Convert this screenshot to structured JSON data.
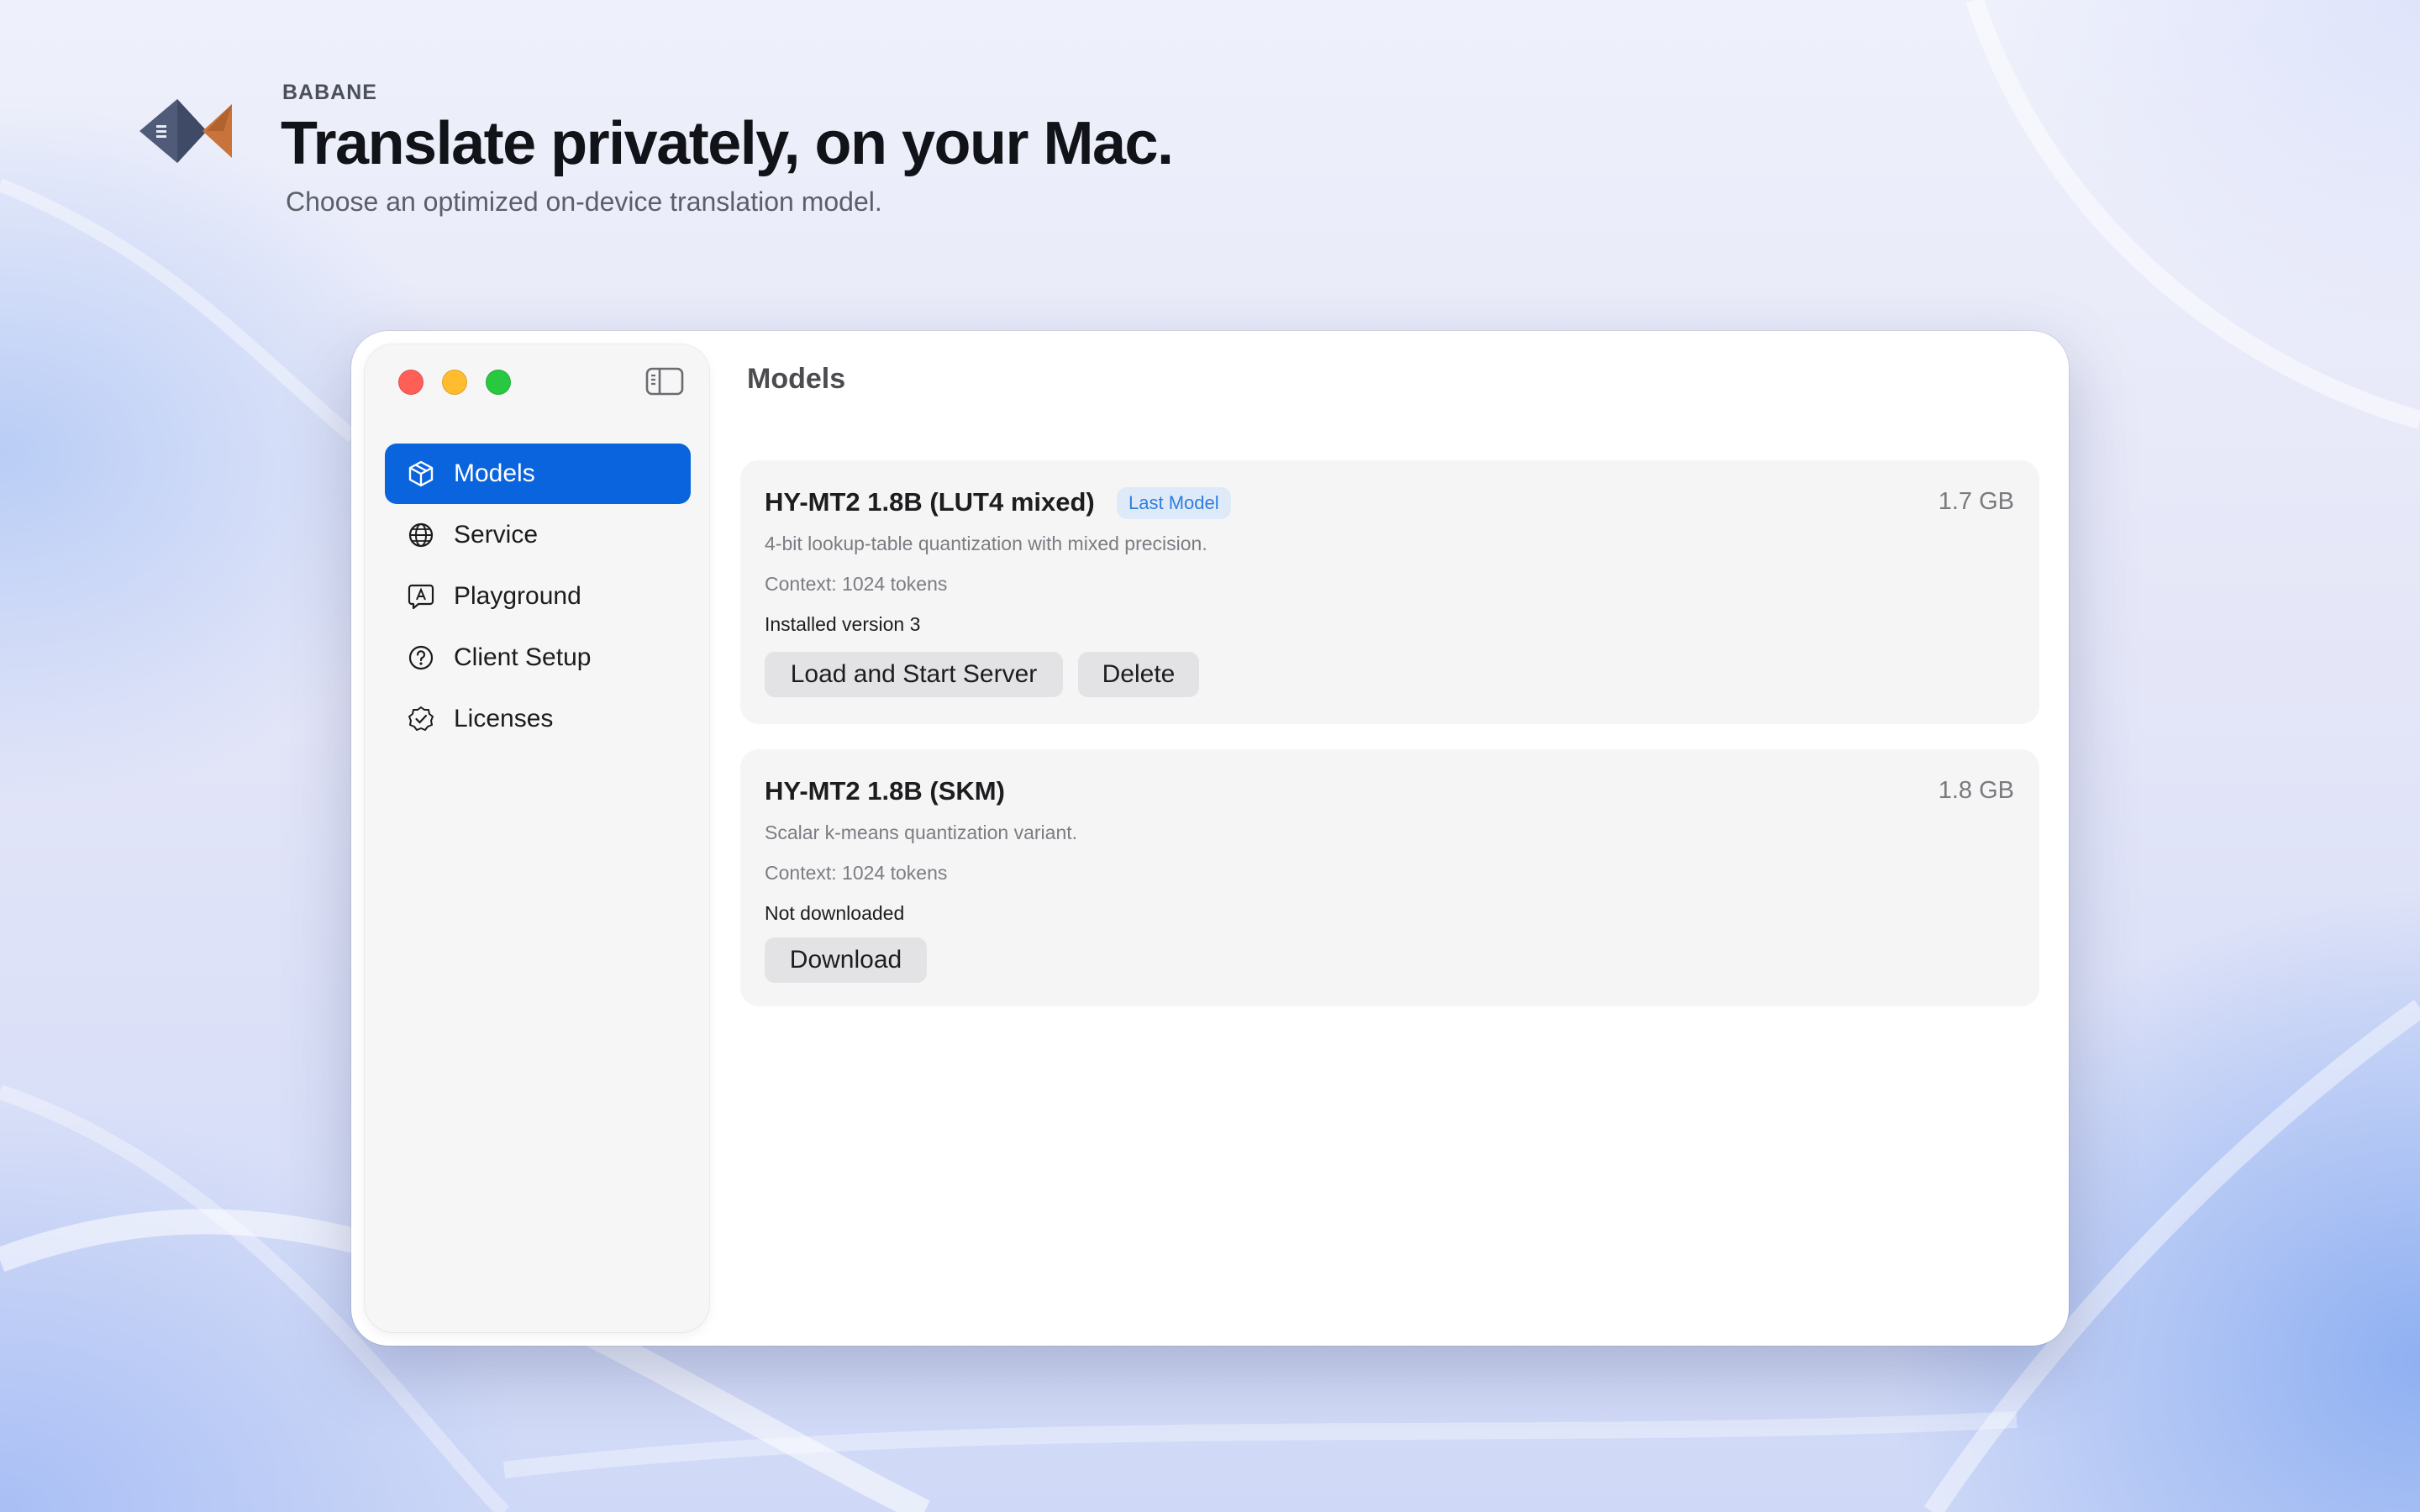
{
  "header": {
    "brand": "BABANE",
    "headline": "Translate privately, on your Mac.",
    "subline": "Choose an optimized on-device translation model.",
    "logo_icon": "babane-fish-logo"
  },
  "window": {
    "title": "Models",
    "sidebar": {
      "toggle_icon": "sidebar-toggle-icon",
      "items": [
        {
          "label": "Models",
          "icon": "cube-icon",
          "active": true
        },
        {
          "label": "Service",
          "icon": "globe-icon",
          "active": false
        },
        {
          "label": "Playground",
          "icon": "chat-bubble-icon",
          "active": false
        },
        {
          "label": "Client Setup",
          "icon": "question-circle-icon",
          "active": false
        },
        {
          "label": "Licenses",
          "icon": "checkmark-seal-icon",
          "active": false
        }
      ]
    },
    "models": [
      {
        "name": "HY-MT2 1.8B (LUT4 mixed)",
        "badge": "Last Model",
        "size": "1.7 GB",
        "description": "4-bit lookup-table quantization with mixed precision.",
        "context": "Context: 1024 tokens",
        "status": "Installed version 3",
        "buttons": [
          "Load and Start Server",
          "Delete"
        ]
      },
      {
        "name": "HY-MT2 1.8B (SKM)",
        "size": "1.8 GB",
        "description": "Scalar k-means quantization variant.",
        "context": "Context: 1024 tokens",
        "status": "Not downloaded",
        "buttons": [
          "Download"
        ]
      }
    ]
  },
  "colors": {
    "accent": "#0a64dd",
    "badge_bg": "#dfeaf9",
    "badge_text": "#2f7de0",
    "close": "#ff5f57",
    "minimize": "#febc2e",
    "zoom": "#28c840"
  }
}
